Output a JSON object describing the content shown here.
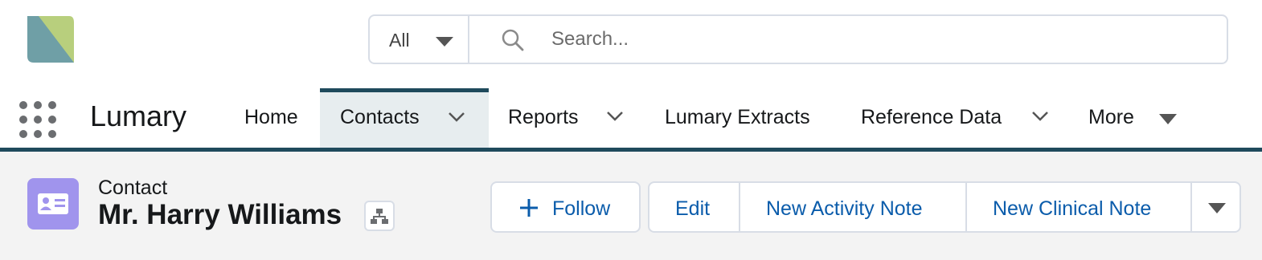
{
  "header": {
    "logo_icon": "lumary-logo-icon",
    "search_scope": "All",
    "search_placeholder": "Search...",
    "search_value": ""
  },
  "nav": {
    "app_launcher_icon": "app-launcher-grid-icon",
    "app_name": "Lumary",
    "items": [
      {
        "label": "Home",
        "has_chevron": false
      },
      {
        "label": "Contacts",
        "has_chevron": true,
        "active": true
      },
      {
        "label": "Reports",
        "has_chevron": true
      },
      {
        "label": "Lumary Extracts",
        "has_chevron": false
      },
      {
        "label": "Reference Data",
        "has_chevron": true
      },
      {
        "label": "More",
        "has_caret": true
      }
    ],
    "accent_color": "#1f4a5c"
  },
  "record": {
    "object_type": "Contact",
    "name": "Mr. Harry Williams",
    "object_icon": "contact-card-icon",
    "object_icon_color": "#a094ed",
    "hierarchy_icon": "hierarchy-icon",
    "actions": {
      "follow": "Follow",
      "edit": "Edit",
      "new_activity_note": "New Activity Note",
      "new_clinical_note": "New Clinical Note"
    },
    "link_color": "#0b5cab"
  }
}
